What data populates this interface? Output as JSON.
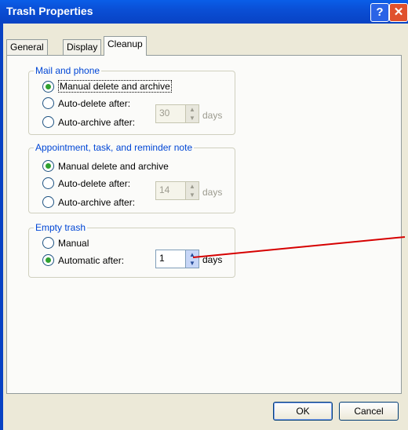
{
  "window": {
    "title": "Trash Properties",
    "help": "?",
    "close": "✕"
  },
  "tabs": [
    "General",
    "Display",
    "Cleanup"
  ],
  "groups": {
    "mail": {
      "title": "Mail and phone",
      "manual": "Manual delete and archive",
      "autodelete": "Auto-delete after:",
      "autoarchive": "Auto-archive after:",
      "days_value": "30",
      "units": "days"
    },
    "appt": {
      "title": "Appointment, task, and reminder note",
      "manual": "Manual delete and archive",
      "autodelete": "Auto-delete after:",
      "autoarchive": "Auto-archive after:",
      "days_value": "14",
      "units": "days"
    },
    "trash": {
      "title": "Empty trash",
      "manual": "Manual",
      "automatic": "Automatic after:",
      "days_value": "1",
      "units": "days"
    }
  },
  "buttons": {
    "ok": "OK",
    "cancel": "Cancel"
  },
  "colors": {
    "title_bar": "#0a4fd6",
    "accent": "#0046d5",
    "selected_radio": "#2fa12f",
    "annotation": "#d60000"
  }
}
